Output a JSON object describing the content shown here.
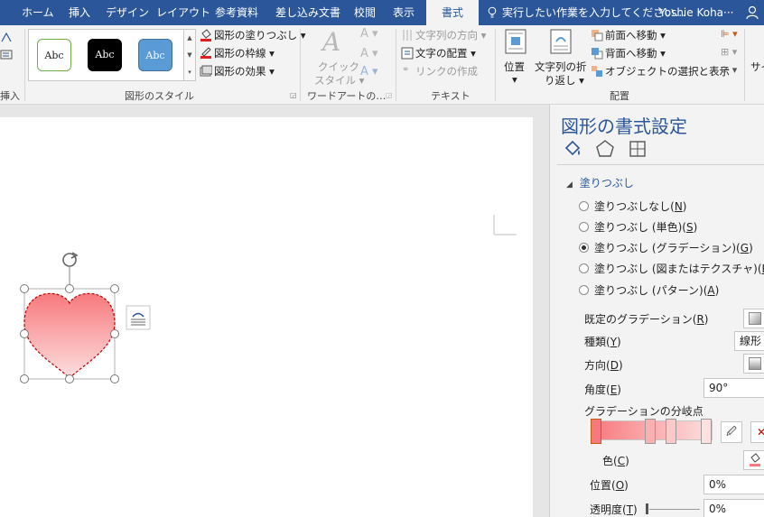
{
  "tabs": {
    "home": "ホーム",
    "insert": "挿入",
    "design": "デザイン",
    "layout": "レイアウト",
    "references": "参考資料",
    "mailings": "差し込み文書",
    "review": "校閲",
    "view": "表示",
    "format": "書式"
  },
  "tell_me": "実行したい作業を入力してください",
  "user_name": "Yoshie Koha···",
  "ribbon": {
    "insert_group_label": "挿入",
    "shape_styles": {
      "swatches": [
        "Abc",
        "Abc",
        "Abc"
      ],
      "fill": "図形の塗りつぶし",
      "outline": "図形の枠線",
      "effects": "図形の効果",
      "label": "図形のスタイル"
    },
    "wordart": {
      "quick_style_line1": "クイック",
      "quick_style_line2": "スタイル",
      "label": "ワードアートの…"
    },
    "text": {
      "direction": "文字列の方向",
      "align": "文字の配置",
      "link": "リンクの作成",
      "label": "テキスト"
    },
    "arrange": {
      "position": "位置",
      "wrap_line1": "文字列の折",
      "wrap_line2": "り返し",
      "bring_forward": "前面へ移動",
      "send_backward": "背面へ移動",
      "selection_pane": "オブジェクトの選択と表示",
      "label": "配置"
    },
    "size_partial": "サイ"
  },
  "pane": {
    "title": "図形の書式設定",
    "section_fill": "塗りつぶし",
    "options": [
      {
        "text": "塗りつぶしなし(",
        "key": "N",
        "selected": false
      },
      {
        "text": "塗りつぶし (単色)(",
        "key": "S",
        "selected": false
      },
      {
        "text": "塗りつぶし (グラデーション)(",
        "key": "G",
        "selected": true
      },
      {
        "text": "塗りつぶし (図またはテクスチャ)(",
        "key": "P",
        "selected": false
      },
      {
        "text": "塗りつぶし (パターン)(",
        "key": "A",
        "selected": false
      }
    ],
    "preset_label": "既定のグラデーション(",
    "preset_key": "R",
    "type_label": "種類(",
    "type_key": "Y",
    "type_value": "線形",
    "direction_label": "方向(",
    "direction_key": "D",
    "angle_label": "角度(",
    "angle_key": "E",
    "angle_value": "90°",
    "stops_label": "グラデーションの分岐点",
    "color_label": "色(",
    "color_key": "C",
    "position_label": "位置(",
    "position_key": "O",
    "position_value": "0%",
    "transparency_label": "透明度(",
    "transparency_key": "T",
    "transparency_value": "0%"
  },
  "colors": {
    "accent": "#2b579a",
    "heart_top": "#f7797d",
    "heart_bottom": "#fde0e0",
    "heart_outline": "#c00000"
  }
}
